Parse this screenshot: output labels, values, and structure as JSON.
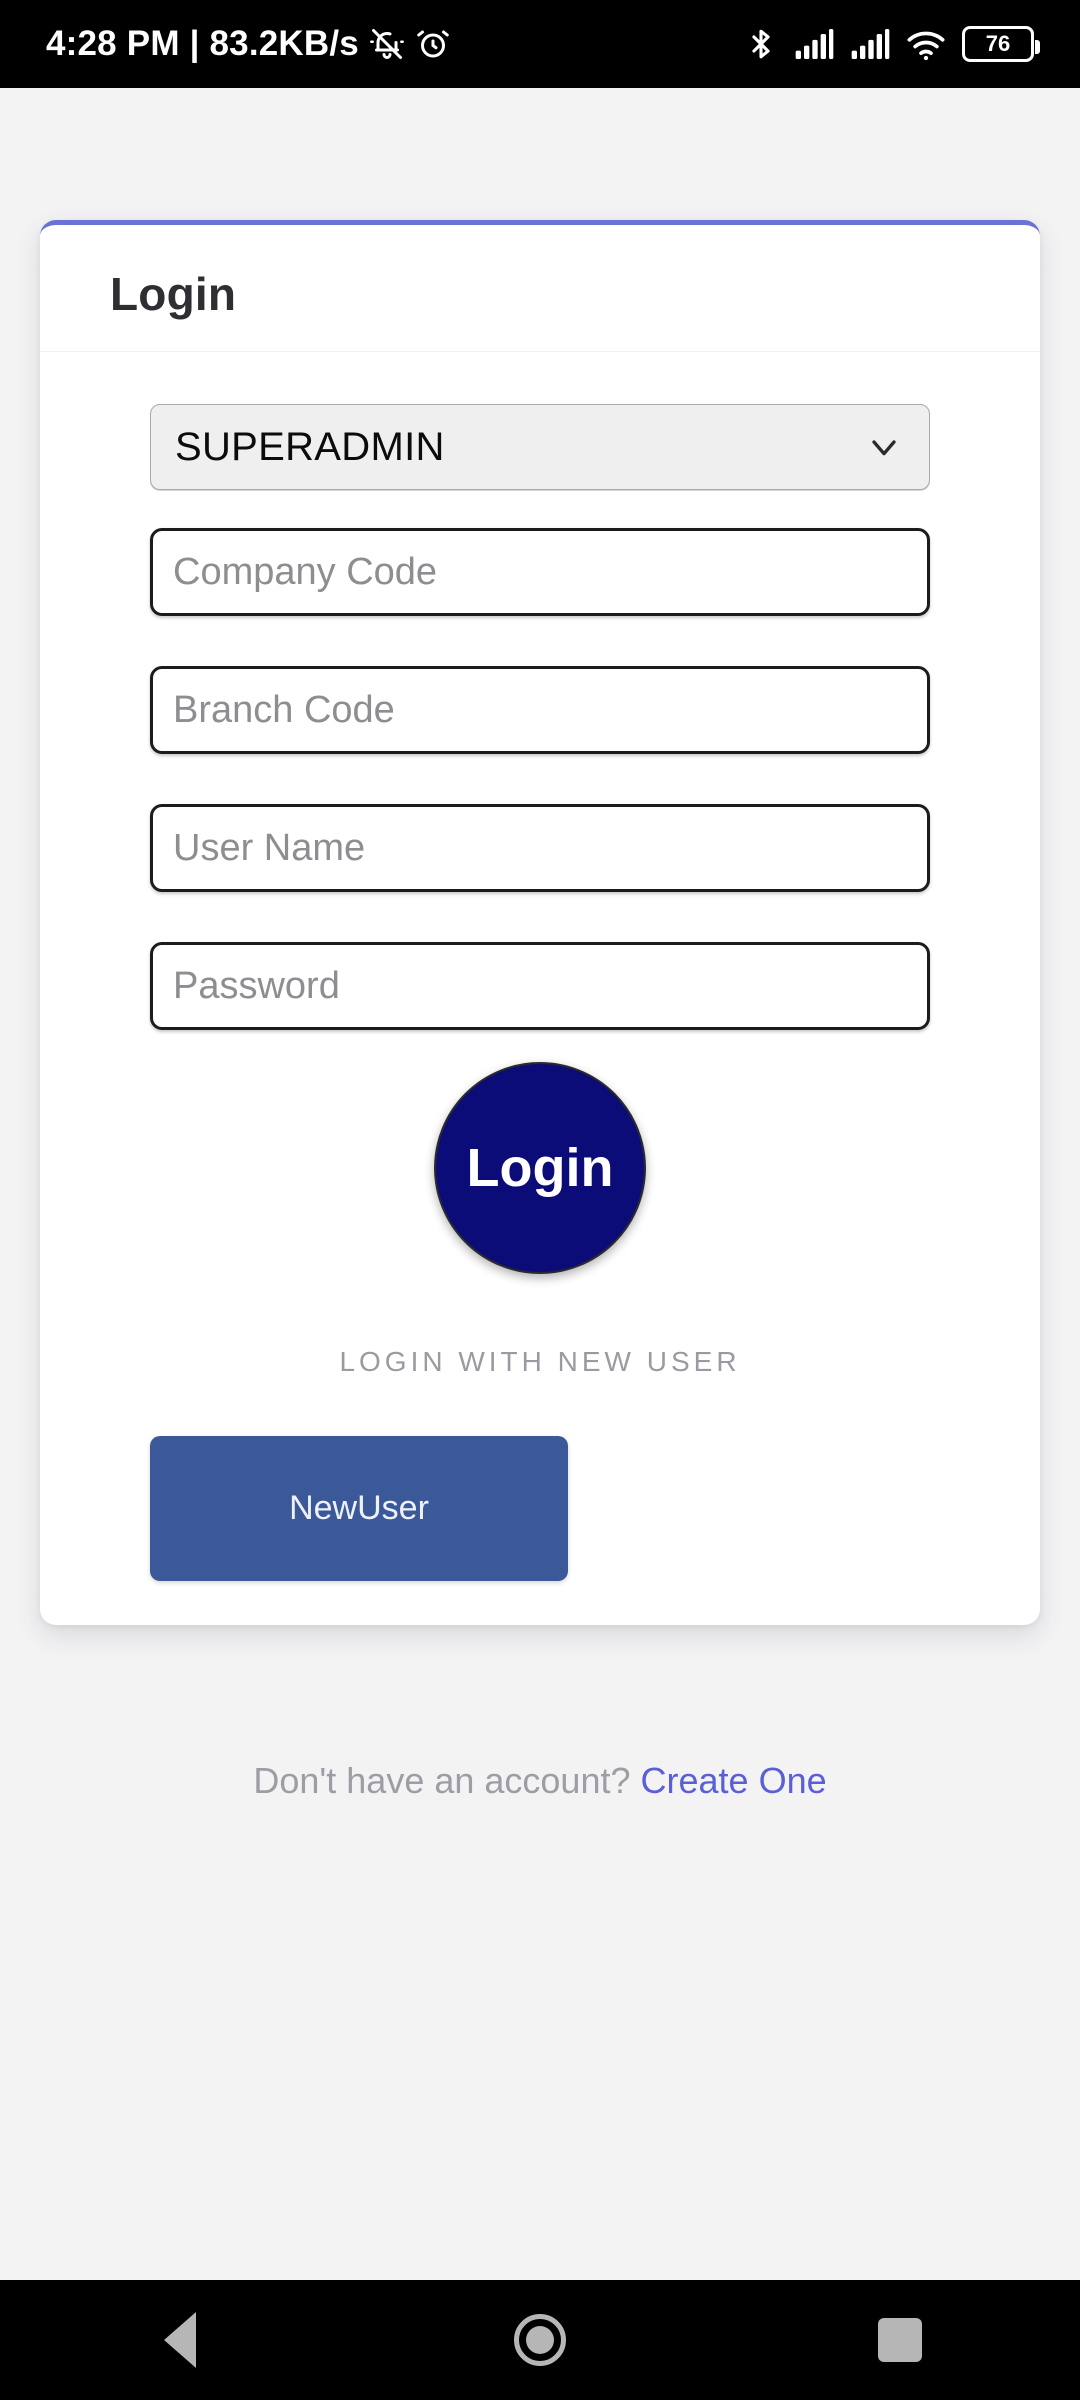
{
  "status_bar": {
    "time_and_network": "4:28 PM | 83.2KB/s",
    "battery_level": "76",
    "icons": [
      "vibrate-off-icon",
      "alarm-clock-icon",
      "bluetooth-icon",
      "signal-sim1-icon",
      "signal-sim2-icon",
      "wifi-icon",
      "battery-icon"
    ]
  },
  "card": {
    "title": "Login",
    "role_select": {
      "value": "SUPERADMIN",
      "options": [
        "SUPERADMIN"
      ]
    },
    "fields": [
      {
        "name": "company-code",
        "placeholder": "Company Code",
        "value": ""
      },
      {
        "name": "branch-code",
        "placeholder": "Branch Code",
        "value": ""
      },
      {
        "name": "user-name",
        "placeholder": "User Name",
        "value": ""
      },
      {
        "name": "password",
        "placeholder": "Password",
        "value": ""
      }
    ],
    "login_button_label": "Login",
    "divider_label": "LOGIN WITH NEW USER",
    "new_user_button_label": "NewUser"
  },
  "footer": {
    "prompt": "Don't have an account?",
    "link": "Create One"
  },
  "nav_bar": {
    "back_label": "Back",
    "home_label": "Home",
    "recents_label": "Recents"
  },
  "colors": {
    "card_top_border": "#6b72d6",
    "login_circle": "#0c0c78",
    "new_user_button": "#3b5998",
    "footer_link": "#5a5fd6",
    "page_background": "#f3f3f4"
  }
}
